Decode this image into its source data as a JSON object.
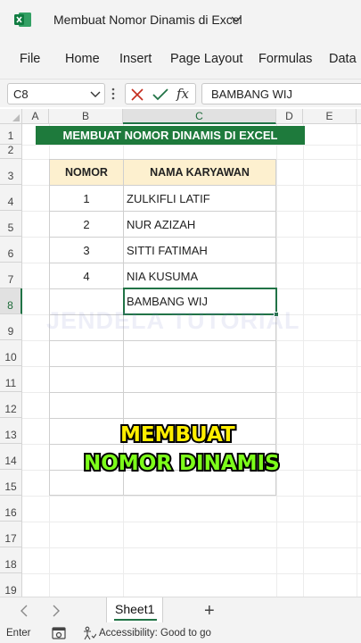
{
  "window": {
    "title": "Membuat Nomor Dinamis di Excel",
    "app_color": "#217346"
  },
  "ribbon": {
    "tabs": [
      "File",
      "Home",
      "Insert",
      "Page Layout",
      "Formulas",
      "Data"
    ]
  },
  "formula_bar": {
    "name_box": "C8",
    "fx_label": "fx",
    "formula_value": "BAMBANG WIJ"
  },
  "grid": {
    "columns": [
      "A",
      "B",
      "C",
      "D",
      "E"
    ],
    "rows": [
      "1",
      "2",
      "3",
      "4",
      "5",
      "6",
      "7",
      "8",
      "9",
      "10",
      "11",
      "12",
      "13",
      "14",
      "15",
      "16",
      "17",
      "18",
      "19"
    ],
    "selected_column": "C",
    "selected_row": "8"
  },
  "sheet": {
    "banner": "MEMBUAT NOMOR DINAMIS DI EXCEL",
    "header_nomor": "NOMOR",
    "header_nama": "NAMA KARYAWAN",
    "records": [
      {
        "nomor": "1",
        "nama": "ZULKIFLI LATIF"
      },
      {
        "nomor": "2",
        "nama": "NUR AZIZAH"
      },
      {
        "nomor": "3",
        "nama": "SITTI FATIMAH"
      },
      {
        "nomor": "4",
        "nama": "NIA KUSUMA"
      },
      {
        "nomor": "",
        "nama": "BAMBANG WIJ"
      }
    ],
    "watermark": "JENDELA TUTORIAL"
  },
  "overlay": {
    "line1": "MEMBUAT",
    "line2": "NOMOR DINAMIS"
  },
  "tabs_bar": {
    "active_sheet": "Sheet1",
    "add_label": "+"
  },
  "status_bar": {
    "mode": "Enter",
    "accessibility": "Accessibility: Good to go"
  }
}
